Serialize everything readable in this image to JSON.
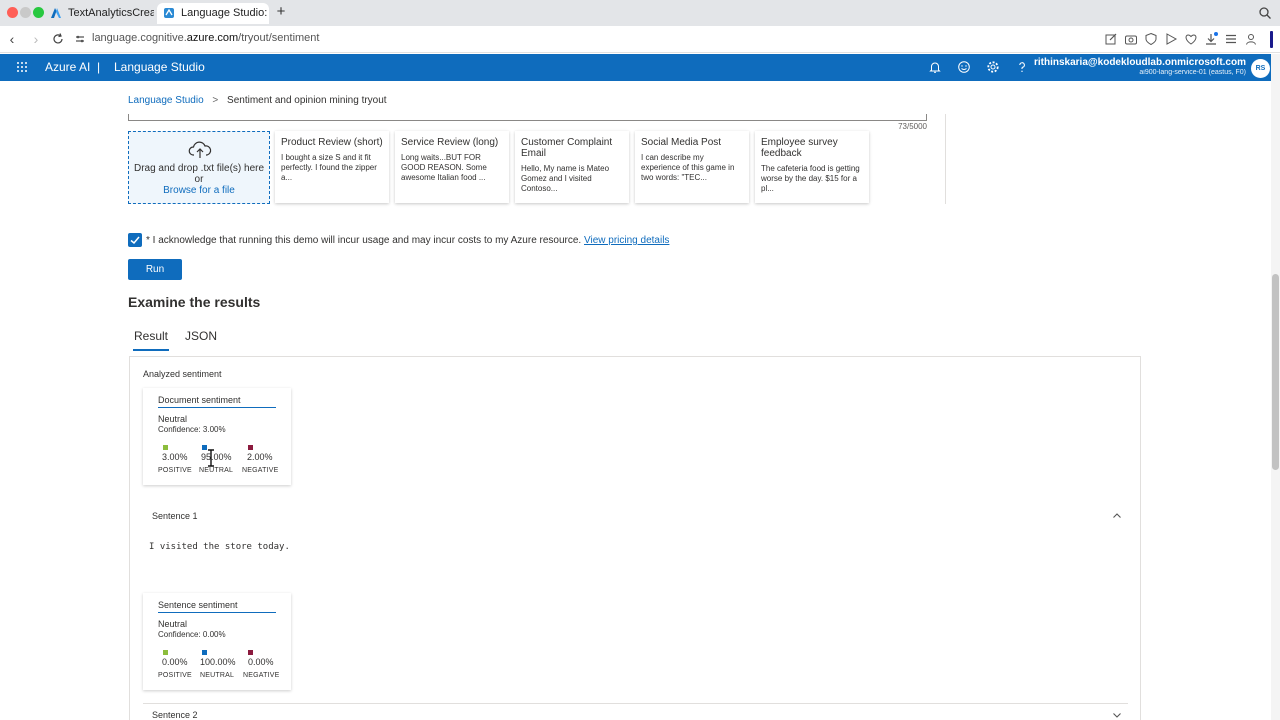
{
  "browser": {
    "tabs": [
      {
        "title": "TextAnalyticsCreate-20…",
        "active": false
      },
      {
        "title": "Language Studio: Senti…",
        "active": true
      }
    ],
    "url_prefix": "language.cognitive.",
    "url_domain": "azure.com",
    "url_path": "/tryout/sentiment"
  },
  "header": {
    "brand": "Azure AI",
    "separator": "|",
    "product": "Language Studio",
    "user_email": "rithinskaria@kodekloudlab.onmicrosoft.com",
    "user_resource": "ai900-lang-service-01 (eastus, F0)",
    "avatar_initials": "RS"
  },
  "breadcrumb": {
    "root": "Language Studio",
    "separator": ">",
    "current": "Sentiment and opinion mining tryout"
  },
  "input": {
    "counter": "73/5000"
  },
  "dropzone": {
    "line1": "Drag and drop .txt file(s) here",
    "line2": "or",
    "browse": "Browse for a file"
  },
  "samples": [
    {
      "title": "Product Review (short)",
      "body": "I bought a size S and it fit perfectly. I found the zipper a..."
    },
    {
      "title": "Service Review (long)",
      "body": "Long waits...BUT FOR GOOD REASON. Some awesome Italian food ..."
    },
    {
      "title": "Customer Complaint Email",
      "body": "Hello, My name is Mateo Gomez and I visited Contoso..."
    },
    {
      "title": "Social Media Post",
      "body": "I can describe my experience of this game in two words: \"TEC..."
    },
    {
      "title": "Employee survey feedback",
      "body": "The cafeteria food is getting worse by the day. $15 for a pl..."
    }
  ],
  "acknowledge": {
    "text": "* I acknowledge that running this demo will incur usage and may incur costs to my Azure resource.",
    "link": "View pricing details",
    "checked": true
  },
  "run_label": "Run",
  "examine_title": "Examine the results",
  "result_tabs": {
    "result": "Result",
    "json": "JSON"
  },
  "results": {
    "analyzed_label": "Analyzed sentiment",
    "document": {
      "title": "Document sentiment",
      "label": "Neutral",
      "confidence": "Confidence: 3.00%",
      "positive": "3.00%",
      "neutral": "95.00%",
      "negative": "2.00%",
      "positive_cap": "POSITIVE",
      "neutral_cap": "NEUTRAL",
      "negative_cap": "NEGATIVE"
    },
    "sentence1": {
      "heading": "Sentence 1",
      "text": "I visited the store today.",
      "card": {
        "title": "Sentence sentiment",
        "label": "Neutral",
        "confidence": "Confidence: 0.00%",
        "positive": "0.00%",
        "neutral": "100.00%",
        "negative": "0.00%",
        "positive_cap": "POSITIVE",
        "neutral_cap": "NEUTRAL",
        "negative_cap": "NEGATIVE"
      }
    },
    "sentence2": {
      "heading": "Sentence 2"
    }
  },
  "colors": {
    "accent": "#0f6cbd",
    "positive": "#8cbd3c",
    "neutral": "#0f6cbd",
    "negative": "#8b1a3e"
  }
}
